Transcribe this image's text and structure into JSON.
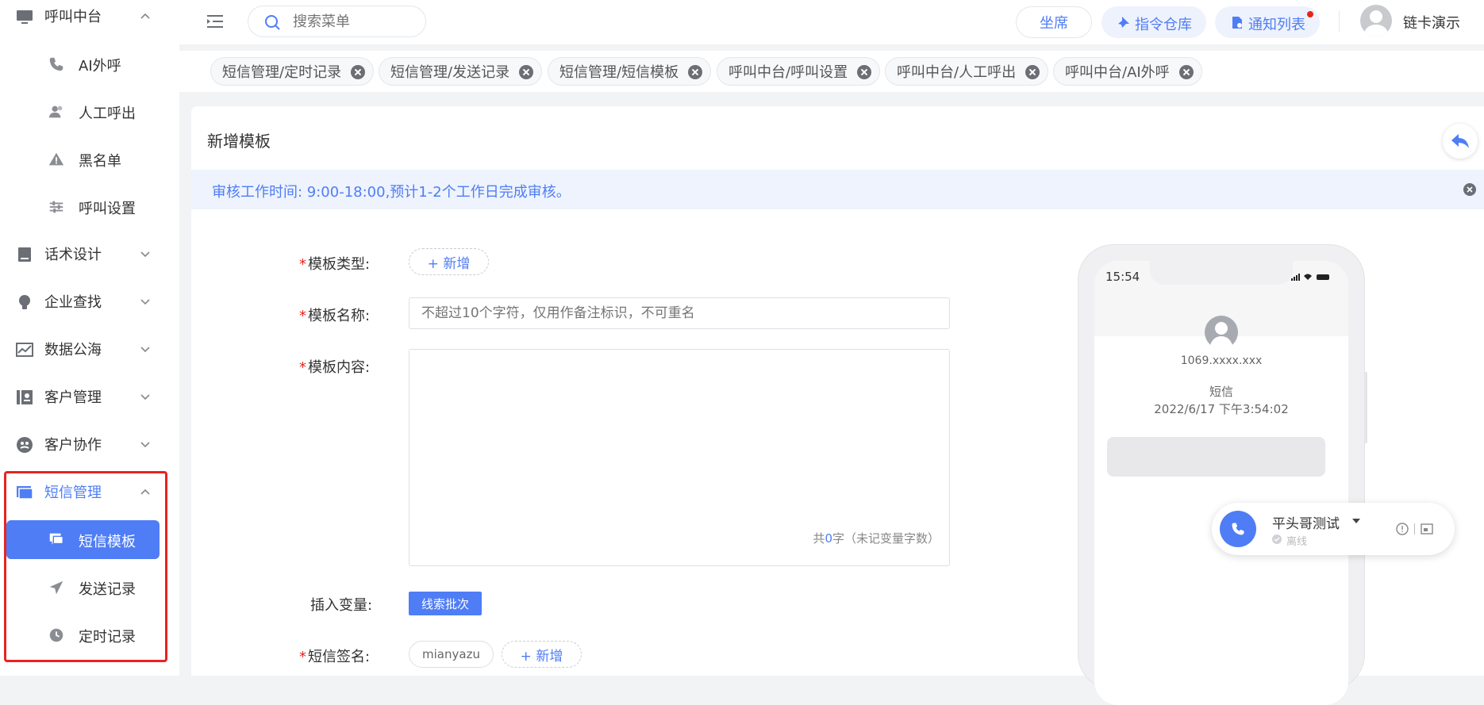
{
  "sidebar": {
    "groups": [
      {
        "label": "呼叫中台",
        "icon": "monitor-icon",
        "expanded": true
      },
      {
        "label": "话术设计",
        "icon": "book-icon"
      },
      {
        "label": "企业查找",
        "icon": "bulb-icon"
      },
      {
        "label": "数据公海",
        "icon": "chart-icon"
      },
      {
        "label": "客户管理",
        "icon": "contacts-icon"
      },
      {
        "label": "客户协作",
        "icon": "team-icon"
      },
      {
        "label": "短信管理",
        "icon": "message-icon",
        "expanded": true
      }
    ],
    "sub_call": [
      {
        "label": "AI外呼",
        "icon": "phone-icon"
      },
      {
        "label": "人工呼出",
        "icon": "user-icon"
      },
      {
        "label": "黑名单",
        "icon": "warning-icon"
      },
      {
        "label": "呼叫设置",
        "icon": "sliders-icon"
      }
    ],
    "sub_sms": [
      {
        "label": "短信模板",
        "icon": "chat-icon",
        "active": true
      },
      {
        "label": "发送记录",
        "icon": "send-icon"
      },
      {
        "label": "定时记录",
        "icon": "clock-icon"
      }
    ]
  },
  "topbar": {
    "search_placeholder": "搜索菜单",
    "seat": "坐席",
    "command_repo": "指令仓库",
    "notify_list": "通知列表",
    "user_name": "链卡演示"
  },
  "tags": [
    "短信管理/定时记录",
    "短信管理/发送记录",
    "短信管理/短信模板",
    "呼叫中台/呼叫设置",
    "呼叫中台/人工呼出",
    "呼叫中台/AI外呼"
  ],
  "page": {
    "title": "新增模板",
    "notice": "审核工作时间: 9:00-18:00,预计1-2个工作日完成审核。"
  },
  "form": {
    "type_label": "模板类型:",
    "add_label": "+ 新增",
    "name_label": "模板名称:",
    "name_placeholder": "不超过10个字符，仅用作备注标识，不可重名",
    "content_label": "模板内容:",
    "count_prefix": "共",
    "count_value": "0",
    "count_suffix": "字（未记变量字数）",
    "insert_label": "插入变量:",
    "insert_btn": "线索批次",
    "sign_label": "短信签名:",
    "sign_chip": "mianyazu",
    "sign_add": "+ 新增"
  },
  "phone": {
    "time": "15:54",
    "number": "1069.xxxx.xxx",
    "kind": "短信",
    "datetime": "2022/6/17 下午3:54:02"
  },
  "call_widget": {
    "name": "平头哥测试",
    "status": "离线"
  },
  "colors": {
    "accent": "#4f7df5",
    "danger": "#e8231f"
  }
}
